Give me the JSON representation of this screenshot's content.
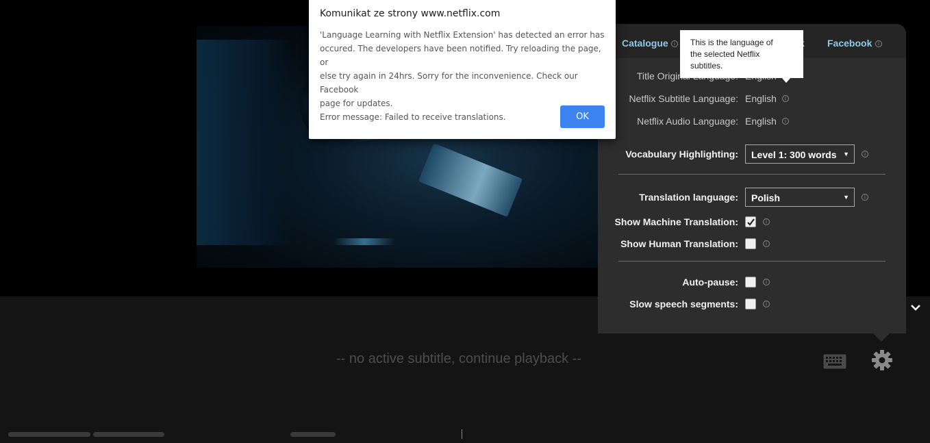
{
  "dialog": {
    "title": "Komunikat ze strony www.netflix.com",
    "message_lines": [
      "'Language Learning with Netflix Extension' has detected an error has",
      "occured. The developers have been notified. Try reloading the page, or",
      "else try again in 24hrs. Sorry for the inconvenience. Check our Facebook",
      "page for updates."
    ],
    "error_line": "Error message: Failed to receive translations.",
    "ok_label": "OK"
  },
  "player": {
    "no_subtitle_text": "-- no active subtitle, continue playback --"
  },
  "settings": {
    "tabs": [
      {
        "label": "Catalogue"
      },
      {
        "label": "k"
      },
      {
        "label": "Facebook"
      }
    ],
    "tooltip": {
      "lines": [
        "This is the language of",
        "the selected Netflix",
        "subtitles."
      ]
    },
    "title_original_language": {
      "label": "Title Original Language:",
      "value": "English"
    },
    "subtitle_language": {
      "label": "Netflix Subtitle Language:",
      "value": "English"
    },
    "audio_language": {
      "label": "Netflix Audio Language:",
      "value": "English"
    },
    "vocabulary": {
      "label": "Vocabulary Highlighting:",
      "selected": "Level 1: 300 words"
    },
    "translation_language": {
      "label": "Translation language:",
      "selected": "Polish"
    },
    "machine_translation": {
      "label": "Show Machine Translation:",
      "checked": true
    },
    "human_translation": {
      "label": "Show Human Translation:",
      "checked": false
    },
    "auto_pause": {
      "label": "Auto-pause:",
      "checked": false
    },
    "slow_speech": {
      "label": "Slow speech segments:",
      "checked": false
    },
    "info_glyph": "i"
  },
  "colors": {
    "accent_link": "#8ecbe9",
    "ok_button": "#3c84f0",
    "panel_bg": "#2d2d2d"
  },
  "icons": [
    "keyboard-icon",
    "gear-icon",
    "chevron-down-icon",
    "info-icon",
    "checkmark-icon"
  ]
}
